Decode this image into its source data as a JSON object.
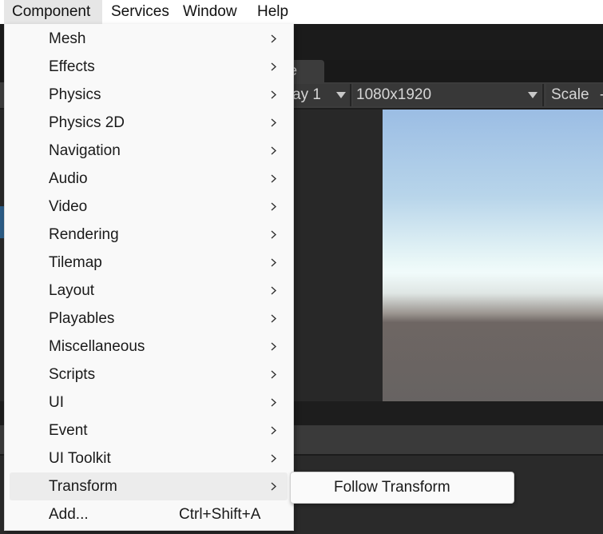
{
  "menubar": {
    "items": [
      {
        "label": "Component"
      },
      {
        "label": "Services"
      },
      {
        "label": "Window"
      },
      {
        "label": "Help"
      }
    ]
  },
  "editor": {
    "game_tab_label": "e",
    "display_value": "ay 1",
    "resolution_value": "1080x1920",
    "scale_label": "Scale",
    "scale_suffix": "-"
  },
  "component_menu": {
    "items": [
      {
        "label": "Mesh",
        "submenu": true
      },
      {
        "label": "Effects",
        "submenu": true
      },
      {
        "label": "Physics",
        "submenu": true
      },
      {
        "label": "Physics 2D",
        "submenu": true
      },
      {
        "label": "Navigation",
        "submenu": true
      },
      {
        "label": "Audio",
        "submenu": true
      },
      {
        "label": "Video",
        "submenu": true
      },
      {
        "label": "Rendering",
        "submenu": true
      },
      {
        "label": "Tilemap",
        "submenu": true
      },
      {
        "label": "Layout",
        "submenu": true
      },
      {
        "label": "Playables",
        "submenu": true
      },
      {
        "label": "Miscellaneous",
        "submenu": true
      },
      {
        "label": "Scripts",
        "submenu": true
      },
      {
        "label": "UI",
        "submenu": true
      },
      {
        "label": "Event",
        "submenu": true
      },
      {
        "label": "UI Toolkit",
        "submenu": true
      },
      {
        "label": "Transform",
        "submenu": true,
        "highlighted": true
      },
      {
        "label": "Add...",
        "shortcut": "Ctrl+Shift+A"
      }
    ]
  },
  "transform_submenu": {
    "items": [
      {
        "label": "Follow Transform"
      }
    ]
  },
  "colors": {
    "menu_bg": "#f9f9f9",
    "highlight_bg": "#ececec",
    "editor_dark": "#282828",
    "toolbar": "#3c3c3c"
  }
}
